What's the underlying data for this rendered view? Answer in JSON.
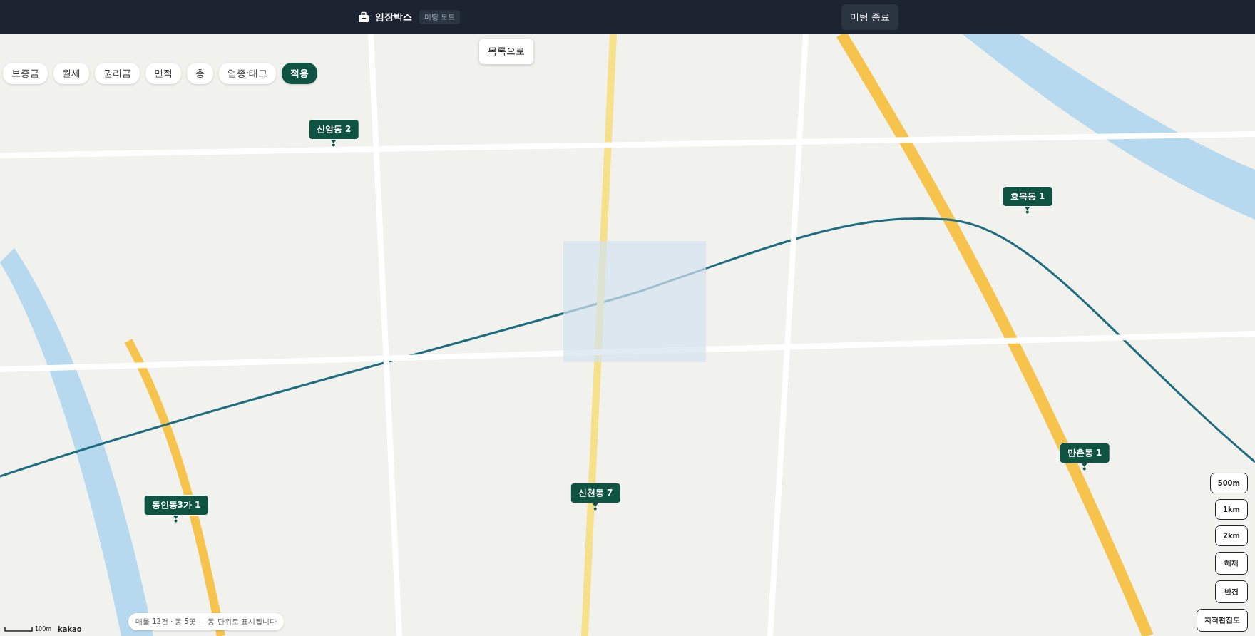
{
  "header": {
    "brand": "임장박스",
    "mode_badge": "미팅 모드",
    "end_button": "미팅 종료"
  },
  "filters": [
    {
      "label": "보증금",
      "kind": "chip"
    },
    {
      "label": "월세",
      "kind": "chip"
    },
    {
      "label": "권리금",
      "kind": "chip"
    },
    {
      "label": "면적",
      "kind": "chip"
    },
    {
      "label": "층",
      "kind": "chip"
    },
    {
      "label": "업종·태그",
      "kind": "chip"
    },
    {
      "label": "적용",
      "kind": "apply"
    }
  ],
  "list_button": "목록으로",
  "markers": [
    {
      "label": "신암동 2"
    },
    {
      "label": "효목동 1"
    },
    {
      "label": "만촌동 1"
    },
    {
      "label": "신천동 7"
    },
    {
      "label": "동인동3가 1"
    }
  ],
  "radius_buttons": [
    "500m",
    "1km",
    "2km",
    "해제",
    "반경",
    "지적편집도"
  ],
  "notice": "매물 12건 · 동 5곳 — 동 단위로 표시됩니다",
  "scale": {
    "label": "100m"
  },
  "map_logo": "kakao"
}
